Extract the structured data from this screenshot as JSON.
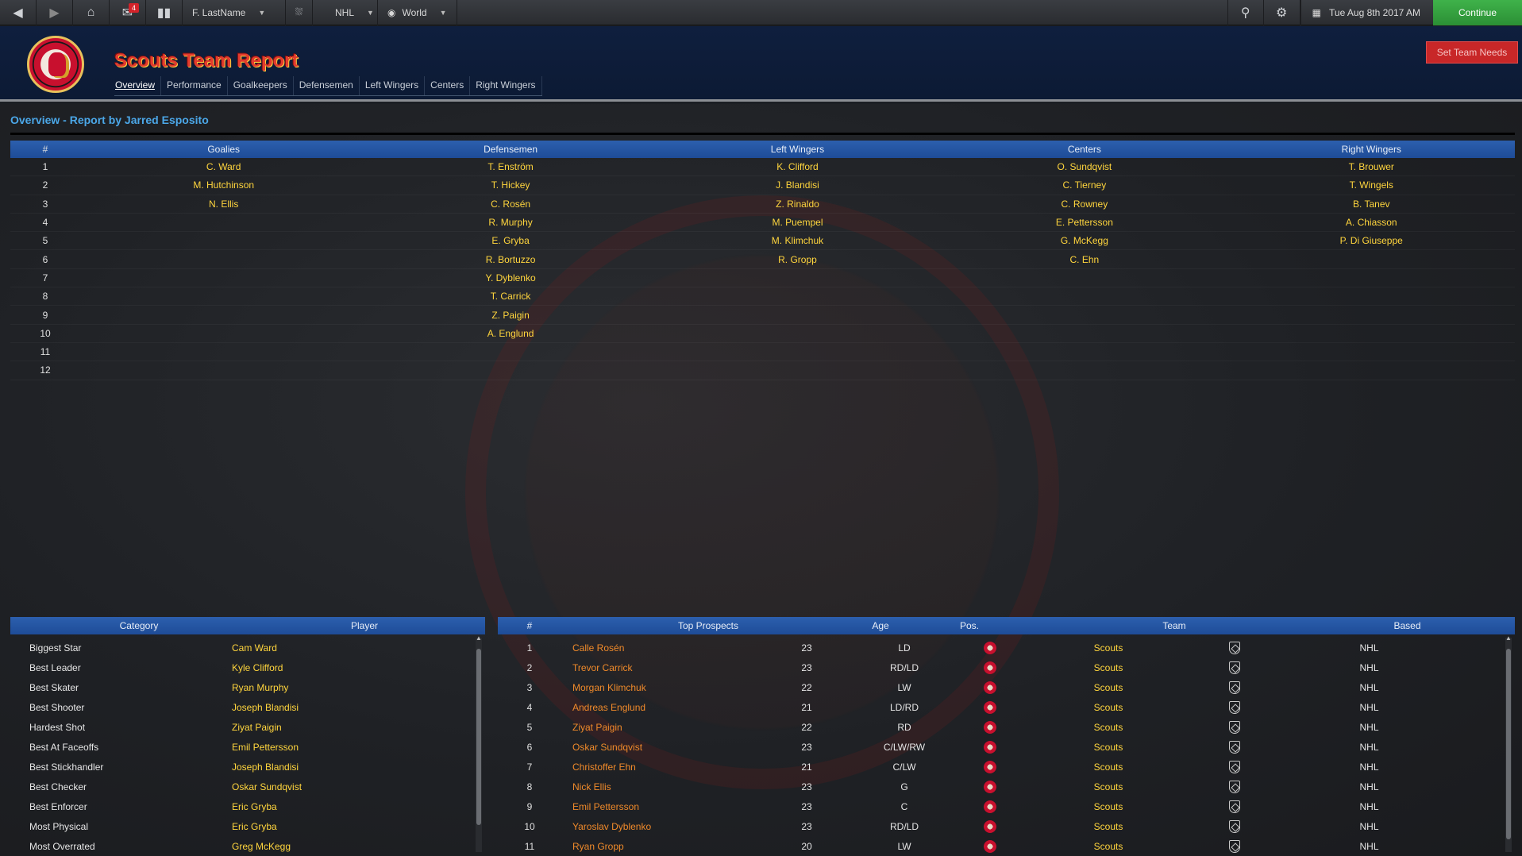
{
  "topbar": {
    "back_icon": "back-arrow-icon",
    "forward_icon": "forward-arrow-icon",
    "home_icon": "home-icon",
    "inbox_badge": "4",
    "profile_dropdown": "F. LastName",
    "league_dropdown": "NHL",
    "world_dropdown": "World",
    "date": "Tue Aug 8th 2017 AM",
    "continue_label": "Continue"
  },
  "header": {
    "title": "Scouts Team Report",
    "set_needs_label": "Set Team Needs",
    "tabs": [
      {
        "label": "Overview"
      },
      {
        "label": "Performance"
      },
      {
        "label": "Goalkeepers"
      },
      {
        "label": "Defensemen"
      },
      {
        "label": "Left Wingers"
      },
      {
        "label": "Centers"
      },
      {
        "label": "Right Wingers"
      }
    ]
  },
  "overview": {
    "section_title": "Overview - Report by Jarred Esposito",
    "headers": [
      "#",
      "Goalies",
      "Defensemen",
      "Left Wingers",
      "Centers",
      "Right Wingers"
    ],
    "rows": [
      {
        "num": "1",
        "g": "C. Ward",
        "d": "T. Enström",
        "lw": "K. Clifford",
        "c": "O. Sundqvist",
        "rw": "T. Brouwer"
      },
      {
        "num": "2",
        "g": "M. Hutchinson",
        "d": "T. Hickey",
        "lw": "J. Blandisi",
        "c": "C. Tierney",
        "rw": "T. Wingels"
      },
      {
        "num": "3",
        "g": "N. Ellis",
        "d": "C. Rosén",
        "lw": "Z. Rinaldo",
        "c": "C. Rowney",
        "rw": "B. Tanev"
      },
      {
        "num": "4",
        "g": "",
        "d": "R. Murphy",
        "lw": "M. Puempel",
        "c": "E. Pettersson",
        "rw": "A. Chiasson"
      },
      {
        "num": "5",
        "g": "",
        "d": "E. Gryba",
        "lw": "M. Klimchuk",
        "c": "G. McKegg",
        "rw": "P. Di Giuseppe"
      },
      {
        "num": "6",
        "g": "",
        "d": "R. Bortuzzo",
        "lw": "R. Gropp",
        "c": "C. Ehn",
        "rw": ""
      },
      {
        "num": "7",
        "g": "",
        "d": "Y. Dyblenko",
        "lw": "",
        "c": "",
        "rw": ""
      },
      {
        "num": "8",
        "g": "",
        "d": "T. Carrick",
        "lw": "",
        "c": "",
        "rw": ""
      },
      {
        "num": "9",
        "g": "",
        "d": "Z. Paigin",
        "lw": "",
        "c": "",
        "rw": ""
      },
      {
        "num": "10",
        "g": "",
        "d": "A. Englund",
        "lw": "",
        "c": "",
        "rw": ""
      },
      {
        "num": "11",
        "g": "",
        "d": "",
        "lw": "",
        "c": "",
        "rw": ""
      },
      {
        "num": "12",
        "g": "",
        "d": "",
        "lw": "",
        "c": "",
        "rw": ""
      }
    ]
  },
  "categories": {
    "headers": [
      "Category",
      "Player"
    ],
    "rows": [
      {
        "category": "Biggest Star",
        "player": "Cam Ward"
      },
      {
        "category": "Best Leader",
        "player": "Kyle Clifford"
      },
      {
        "category": "Best Skater",
        "player": "Ryan Murphy"
      },
      {
        "category": "Best Shooter",
        "player": "Joseph Blandisi"
      },
      {
        "category": "Hardest Shot",
        "player": "Ziyat Paigin"
      },
      {
        "category": "Best At Faceoffs",
        "player": "Emil Pettersson"
      },
      {
        "category": "Best Stickhandler",
        "player": "Joseph Blandisi"
      },
      {
        "category": "Best Checker",
        "player": "Oskar Sundqvist"
      },
      {
        "category": "Best Enforcer",
        "player": "Eric Gryba"
      },
      {
        "category": "Most Physical",
        "player": "Eric Gryba"
      },
      {
        "category": "Most Overrated",
        "player": "Greg McKegg"
      }
    ]
  },
  "prospects": {
    "headers": [
      "#",
      "Top Prospects",
      "Age",
      "Pos.",
      "Team",
      "Based"
    ],
    "rows": [
      {
        "num": "1",
        "name": "Calle Rosén",
        "age": "23",
        "pos": "LD",
        "team": "Scouts",
        "based": "NHL"
      },
      {
        "num": "2",
        "name": "Trevor Carrick",
        "age": "23",
        "pos": "RD/LD",
        "team": "Scouts",
        "based": "NHL"
      },
      {
        "num": "3",
        "name": "Morgan Klimchuk",
        "age": "22",
        "pos": "LW",
        "team": "Scouts",
        "based": "NHL"
      },
      {
        "num": "4",
        "name": "Andreas Englund",
        "age": "21",
        "pos": "LD/RD",
        "team": "Scouts",
        "based": "NHL"
      },
      {
        "num": "5",
        "name": "Ziyat Paigin",
        "age": "22",
        "pos": "RD",
        "team": "Scouts",
        "based": "NHL"
      },
      {
        "num": "6",
        "name": "Oskar Sundqvist",
        "age": "23",
        "pos": "C/LW/RW",
        "team": "Scouts",
        "based": "NHL"
      },
      {
        "num": "7",
        "name": "Christoffer Ehn",
        "age": "21",
        "pos": "C/LW",
        "team": "Scouts",
        "based": "NHL"
      },
      {
        "num": "8",
        "name": "Nick Ellis",
        "age": "23",
        "pos": "G",
        "team": "Scouts",
        "based": "NHL"
      },
      {
        "num": "9",
        "name": "Emil Pettersson",
        "age": "23",
        "pos": "C",
        "team": "Scouts",
        "based": "NHL"
      },
      {
        "num": "10",
        "name": "Yaroslav Dyblenko",
        "age": "23",
        "pos": "RD/LD",
        "team": "Scouts",
        "based": "NHL"
      },
      {
        "num": "11",
        "name": "Ryan Gropp",
        "age": "20",
        "pos": "LW",
        "team": "Scouts",
        "based": "NHL"
      }
    ]
  },
  "colors": {
    "accent_blue": "#4ba7e8",
    "player_yellow": "#ffd53d",
    "prospect_orange": "#f08a2a",
    "continue_green": "#3fb24a",
    "set_needs_red": "#c82728"
  }
}
